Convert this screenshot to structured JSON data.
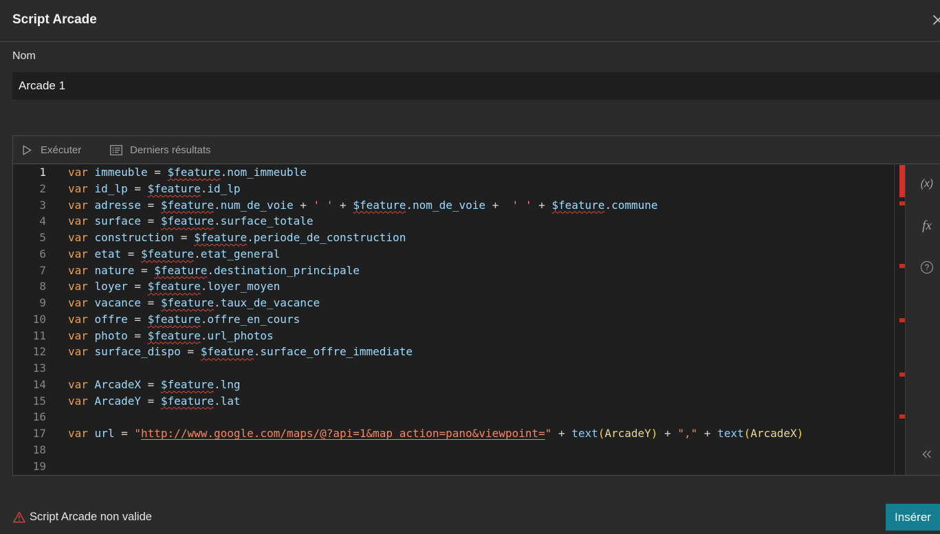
{
  "dialog": {
    "title": "Script Arcade",
    "close_icon": "close-icon"
  },
  "name_field": {
    "label": "Nom",
    "value": "Arcade 1"
  },
  "toolbar": {
    "run": {
      "icon": "play-icon",
      "label": "Exécuter"
    },
    "results": {
      "icon": "console-icon",
      "label": "Derniers résultats"
    }
  },
  "editor": {
    "current_line": 1,
    "lines": [
      {
        "n": "1",
        "code": "var immeuble = $feature.nom_immeuble"
      },
      {
        "n": "2",
        "code": "var id_lp = $feature.id_lp"
      },
      {
        "n": "3",
        "code": "var adresse = $feature.num_de_voie + ' ' + $feature.nom_de_voie +  ' ' + $feature.commune"
      },
      {
        "n": "4",
        "code": "var surface = $feature.surface_totale"
      },
      {
        "n": "5",
        "code": "var construction = $feature.periode_de_construction"
      },
      {
        "n": "6",
        "code": "var etat = $feature.etat_general"
      },
      {
        "n": "7",
        "code": "var nature = $feature.destination_principale"
      },
      {
        "n": "8",
        "code": "var loyer = $feature.loyer_moyen"
      },
      {
        "n": "9",
        "code": "var vacance = $feature.taux_de_vacance"
      },
      {
        "n": "10",
        "code": "var offre = $feature.offre_en_cours"
      },
      {
        "n": "11",
        "code": "var photo = $feature.url_photos"
      },
      {
        "n": "12",
        "code": "var surface_dispo = $feature.surface_offre_immediate"
      },
      {
        "n": "13",
        "code": ""
      },
      {
        "n": "14",
        "code": "var ArcadeX = $feature.lng"
      },
      {
        "n": "15",
        "code": "var ArcadeY = $feature.lat"
      },
      {
        "n": "16",
        "code": ""
      },
      {
        "n": "17",
        "code": "var url = \"http://www.google.com/maps/@?api=1&map_action=pano&viewpoint=\" + text(ArcadeY) + \",\" + text(ArcadeX)"
      },
      {
        "n": "18",
        "code": ""
      },
      {
        "n": "19",
        "code": ""
      }
    ]
  },
  "side_panel": [
    {
      "icon": "variables-icon",
      "glyph": "(x)"
    },
    {
      "icon": "function-icon",
      "glyph": "fx"
    },
    {
      "icon": "help-icon",
      "glyph": "?"
    },
    {
      "icon": "collapse-icon"
    }
  ],
  "status": {
    "icon": "warning-icon",
    "message": "Script Arcade non valide"
  },
  "actions": {
    "insert_label": "Insérer"
  },
  "colors": {
    "background": "#2b2b2b",
    "editor_background": "#1f1f1f",
    "keyword": "#eba14e",
    "identifier": "#9cdcfe",
    "string": "#f2895f",
    "bracket": "#ffd700",
    "error": "#e0453a",
    "primary_button": "#137e91"
  }
}
